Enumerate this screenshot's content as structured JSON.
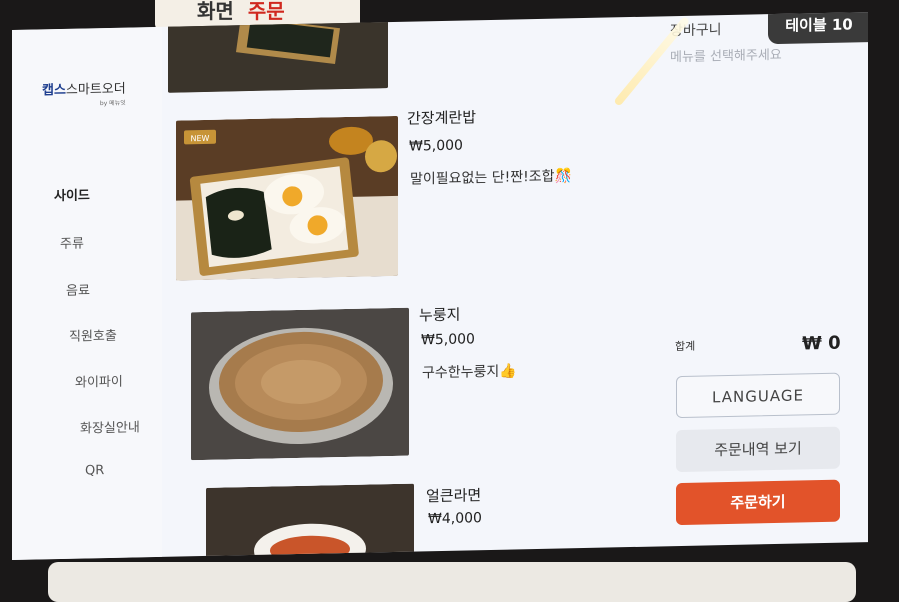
{
  "sticker_text": {
    "left": "화면",
    "right": "주문"
  },
  "brand": {
    "name_bold": "캡스",
    "name_rest": "스마트오더",
    "sub": "by 메뉴잇"
  },
  "categories": [
    {
      "label": "사이드",
      "active": true
    },
    {
      "label": "주류",
      "active": false
    },
    {
      "label": "음료",
      "active": false
    },
    {
      "label": "직원호출",
      "active": false
    },
    {
      "label": "와이파이",
      "active": false
    },
    {
      "label": "화장실안내",
      "active": false
    },
    {
      "label": "QR",
      "active": false
    }
  ],
  "menu_items": [
    {
      "name": "간장계란밥",
      "price": "₩5,000",
      "desc": "말이필요없는 단!짠!조합🎊",
      "badge": "NEW"
    },
    {
      "name": "누룽지",
      "price": "₩5,000",
      "desc": "구수한누룽지👍"
    },
    {
      "name": "얼큰라면",
      "price": "₩4,000"
    }
  ],
  "table_badge": "테이블 10",
  "cart": {
    "title": "장바구니",
    "empty_message": "메뉴를 선택해주세요",
    "total_label": "합계",
    "total_value": "₩ 0"
  },
  "buttons": {
    "language": "LANGUAGE",
    "history": "주문내역 보기",
    "order": "주문하기"
  }
}
